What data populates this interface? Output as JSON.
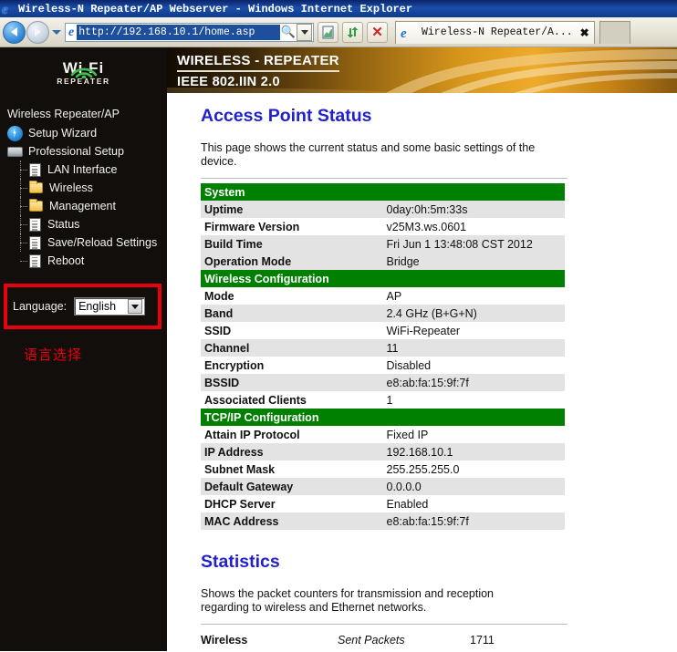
{
  "window": {
    "title": "Wireless-N Repeater/AP Webserver - Windows Internet Explorer",
    "app_icon": "internet-explorer-icon"
  },
  "toolbar": {
    "back_label": "Back",
    "forward_label": "Forward",
    "recent_pages_label": "Recent Pages",
    "address": {
      "url": "http://192.168.10.1/home.asp",
      "placeholder": "Address",
      "search_icon": "search-icon",
      "dropdown_icon": "chevron-down-icon"
    },
    "buttons": [
      {
        "name": "compatibility-view-button",
        "icon": "page-icon"
      },
      {
        "name": "refresh-button",
        "icon": "refresh-icon"
      },
      {
        "name": "stop-button",
        "icon": "close-x-icon",
        "glyph": "✕"
      }
    ],
    "tab": {
      "label": "Wireless-N Repeater/A...",
      "close_glyph": "✖",
      "icon": "internet-explorer-icon"
    },
    "new_tab_label": ""
  },
  "sidebar": {
    "logo": {
      "line1": "Wi Fi",
      "line2": "REPEATER"
    },
    "root_label": "Wireless Repeater/AP",
    "items": [
      {
        "label": "Setup Wizard",
        "icon": "bolt-icon",
        "level": 0
      },
      {
        "label": "Professional Setup",
        "icon": "computer-icon",
        "level": 0
      },
      {
        "label": "LAN Interface",
        "icon": "document-icon",
        "level": 1
      },
      {
        "label": "Wireless",
        "icon": "folder-icon",
        "level": 1
      },
      {
        "label": "Management",
        "icon": "folder-icon",
        "level": 1
      },
      {
        "label": "Status",
        "icon": "document-icon",
        "level": 1
      },
      {
        "label": "Save/Reload Settings",
        "icon": "document-icon",
        "level": 1
      },
      {
        "label": "Reboot",
        "icon": "document-icon",
        "level": 1
      }
    ],
    "language": {
      "label": "Language:",
      "value": "English",
      "options": [
        "English"
      ],
      "dropdown_icon": "chevron-down-icon",
      "highlight_color": "#e8000d"
    },
    "annotation": "语言选择"
  },
  "banner": {
    "line1": "WIRELESS - REPEATER",
    "line2": "IEEE 802.IIN 2.0"
  },
  "main": {
    "heading": "Access Point Status",
    "description": "This page shows the current status and some basic settings of the device.",
    "groups": [
      {
        "title": "System",
        "rows": [
          {
            "key": "Uptime",
            "value": "0day:0h:5m:33s"
          },
          {
            "key": "Firmware Version",
            "value": "v25M3.ws.0601"
          },
          {
            "key": "Build Time",
            "value": "Fri Jun 1 13:48:08 CST 2012"
          },
          {
            "key": "Operation Mode",
            "value": "Bridge"
          }
        ]
      },
      {
        "title": "Wireless Configuration",
        "rows": [
          {
            "key": "Mode",
            "value": "AP"
          },
          {
            "key": "Band",
            "value": "2.4 GHz (B+G+N)"
          },
          {
            "key": "SSID",
            "value": "WiFi-Repeater"
          },
          {
            "key": "Channel",
            "value": "11"
          },
          {
            "key": "Encryption",
            "value": "Disabled"
          },
          {
            "key": "BSSID",
            "value": "e8:ab:fa:15:9f:7f"
          },
          {
            "key": "Associated Clients",
            "value": "1"
          }
        ]
      },
      {
        "title": "TCP/IP Configuration",
        "rows": [
          {
            "key": "Attain IP Protocol",
            "value": "Fixed IP"
          },
          {
            "key": "IP Address",
            "value": "192.168.10.1"
          },
          {
            "key": "Subnet Mask",
            "value": "255.255.255.0"
          },
          {
            "key": "Default Gateway",
            "value": "0.0.0.0"
          },
          {
            "key": "DHCP Server",
            "value": "Enabled"
          },
          {
            "key": "MAC Address",
            "value": "e8:ab:fa:15:9f:7f"
          }
        ]
      }
    ],
    "statistics": {
      "heading": "Statistics",
      "description": "Shows the packet counters for transmission and reception regarding to wireless and Ethernet networks.",
      "rows": [
        {
          "section": "Wireless",
          "metric": "Sent Packets",
          "value": "1711"
        }
      ]
    }
  },
  "theme": {
    "group_header_green": "#008000",
    "heading_blue": "#2222cc",
    "row_shade": "#e3e3e3",
    "sidebar_bg": "#120e0c",
    "banner_orange": "#d4951b"
  }
}
